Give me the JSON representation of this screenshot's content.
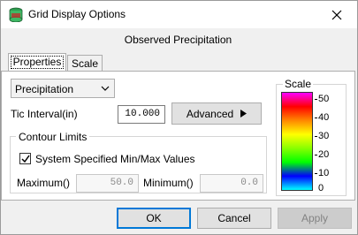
{
  "window": {
    "title": "Grid Display Options",
    "icon": "grid-app-icon"
  },
  "heading": "Observed Precipitation",
  "tabs": [
    {
      "label": "Properties",
      "selected": true
    },
    {
      "label": "Scale",
      "selected": false
    }
  ],
  "variable_select": {
    "value": "Precipitation"
  },
  "tic": {
    "label": "Tic Interval(in)",
    "value": "10.000"
  },
  "advanced_label": "Advanced",
  "contour": {
    "legend": "Contour Limits",
    "checkbox_label": "System Specified Min/Max Values",
    "checked": true,
    "max_label": "Maximum()",
    "max_value": "50.0",
    "min_label": "Minimum()",
    "min_value": "0.0"
  },
  "scale": {
    "title": "Scale",
    "ticks": [
      "50",
      "40",
      "30",
      "20",
      "10",
      "0"
    ],
    "colors": [
      "#ff00ff",
      "#ff0000",
      "#ff8800",
      "#ffff00",
      "#88ff00",
      "#00ff00",
      "#0000ff",
      "#00ffff"
    ]
  },
  "buttons": {
    "ok": "OK",
    "cancel": "Cancel",
    "apply": "Apply"
  }
}
